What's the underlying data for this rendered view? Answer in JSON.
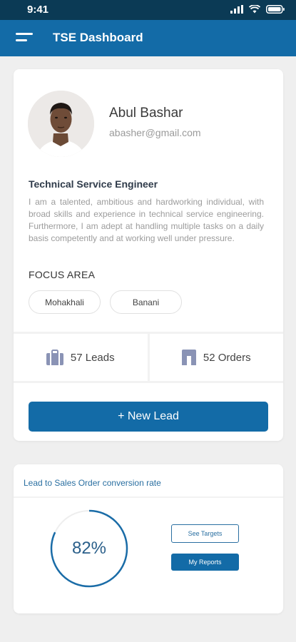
{
  "status_bar": {
    "time": "9:41"
  },
  "app_bar": {
    "title": "TSE Dashboard"
  },
  "profile": {
    "name": "Abul Bashar",
    "email": "abasher@gmail.com",
    "job_title": "Technical Service Engineer",
    "bio": "I am a talented, ambitious and hardworking individual, with broad skills and experience in technical service engineering. Furthermore, I am adept at handling multiple tasks on a daily basis competently and at working well under pressure.",
    "focus_area_label": "FOCUS AREA",
    "focus_areas": [
      "Mohakhali",
      "Banani"
    ]
  },
  "stats": {
    "leads_label": "57 Leads",
    "orders_label": "52 Orders"
  },
  "actions": {
    "new_lead_label": "+ New Lead"
  },
  "conversion": {
    "title": "Lead to Sales Order conversion rate",
    "rate_label": "82%",
    "rate_fraction": 0.82,
    "see_targets_label": "See Targets",
    "my_reports_label": "My Reports"
  },
  "colors": {
    "primary": "#136ba7",
    "status_bar": "#0b3a55",
    "background": "#efefef",
    "icon_muted": "#8a93b5"
  }
}
